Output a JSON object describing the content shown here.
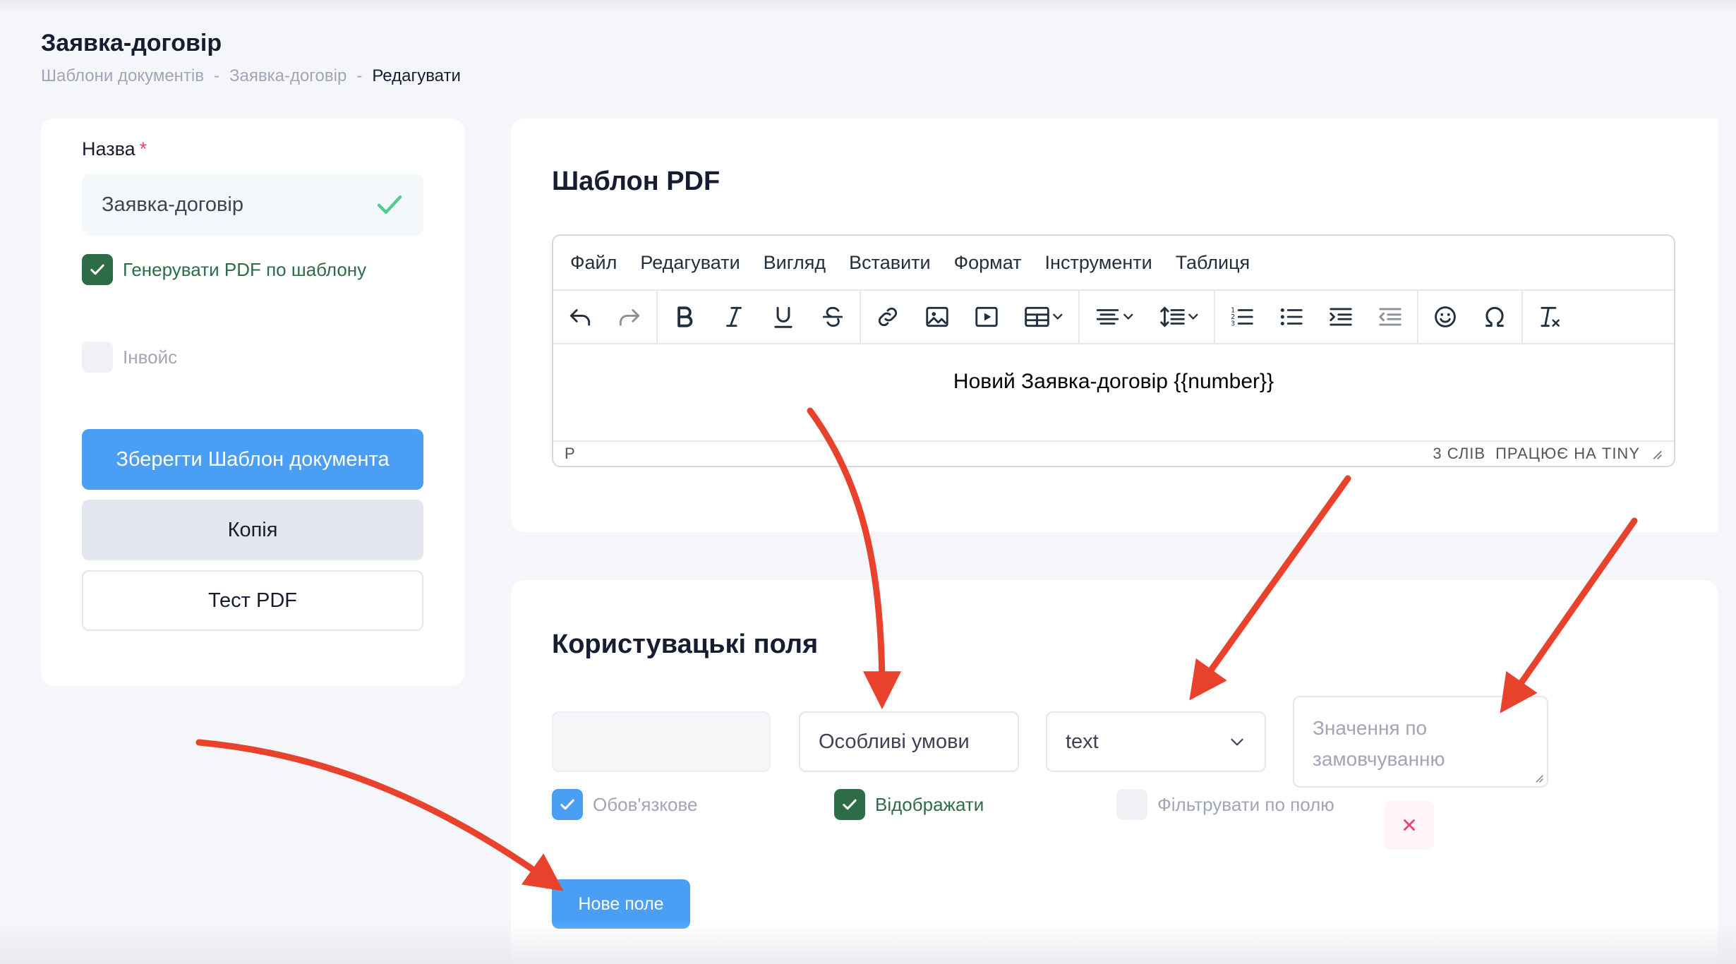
{
  "page": {
    "title": "Заявка-договір",
    "breadcrumb": [
      "Шаблони документів",
      "Заявка-договір",
      "Редагувати"
    ],
    "breadcrumb_sep": "-"
  },
  "left": {
    "name_label": "Назва",
    "required_mark": "*",
    "name_value": "Заявка-договір",
    "generate_pdf_label": "Генерувати PDF по шаблону",
    "generate_pdf_checked": true,
    "invoice_label": "Інвойс",
    "invoice_checked": false,
    "save_button": "Зберегти Шаблон документа",
    "copy_button": "Копія",
    "test_button": "Тест PDF"
  },
  "editor_section": {
    "title": "Шаблон PDF",
    "menu": [
      "Файл",
      "Редагувати",
      "Вигляд",
      "Вставити",
      "Формат",
      "Інструменти",
      "Таблиця"
    ],
    "toolbar_icons": [
      "undo-icon",
      "redo-icon",
      "bold-icon",
      "italic-icon",
      "underline-icon",
      "strikethrough-icon",
      "link-icon",
      "image-icon",
      "media-icon",
      "table-icon",
      "align-icon",
      "line-height-icon",
      "numbered-list-icon",
      "bullet-list-icon",
      "indent-icon",
      "outdent-icon",
      "emoticons-icon",
      "special-char-icon",
      "clear-format-icon"
    ],
    "content": "Новий Заявка-договір {{number}}",
    "status_path": "P",
    "word_count": "3 СЛІВ",
    "powered_by": "ПРАЦЮЄ НА TINY"
  },
  "custom_fields": {
    "title": "Користувацькі поля",
    "field_key_value": "",
    "field_name_value": "Особливі умови",
    "field_type_value": "text",
    "default_placeholder": "Значення по замовчуванню",
    "required_label": "Обов'язкове",
    "required_checked": true,
    "display_label": "Відображати",
    "display_checked": true,
    "filter_label": "Фільтрувати по полю",
    "filter_checked": false,
    "new_field_button": "Нове поле"
  },
  "colors": {
    "primary": "#4a9ff5",
    "success_check": "#50cd89",
    "dark_green": "#2e6b47",
    "danger": "#f1416c",
    "annotation_arrow": "#e8412c"
  }
}
